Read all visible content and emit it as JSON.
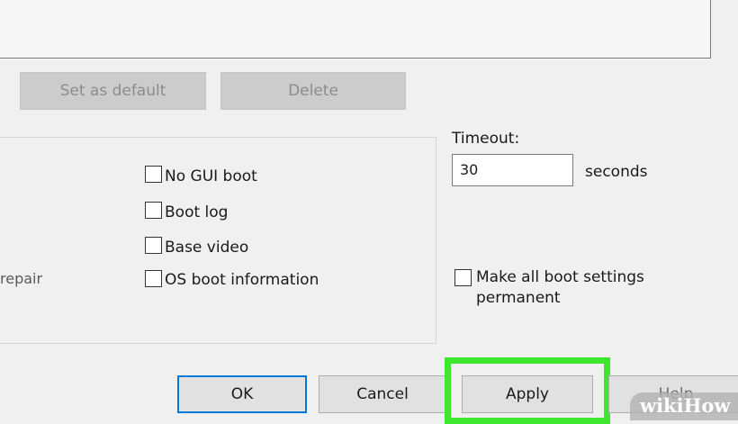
{
  "buttons": {
    "set_default": "Set as default",
    "delete": "Delete",
    "ok": "OK",
    "cancel": "Cancel",
    "apply": "Apply",
    "help": "Help"
  },
  "boot_options": {
    "partial_label": "repair",
    "checkboxes": [
      {
        "label": "No GUI boot",
        "checked": false
      },
      {
        "label": "Boot log",
        "checked": false
      },
      {
        "label": "Base video",
        "checked": false
      },
      {
        "label": "OS boot information",
        "checked": false
      }
    ]
  },
  "timeout": {
    "label": "Timeout:",
    "value": "30",
    "unit": "seconds"
  },
  "permanent": {
    "label_line1": "Make all boot settings",
    "label_line2": "permanent",
    "checked": false
  },
  "highlight_color": "#3ee630",
  "focus_color": "#0078d7",
  "watermark": "wikiHow"
}
